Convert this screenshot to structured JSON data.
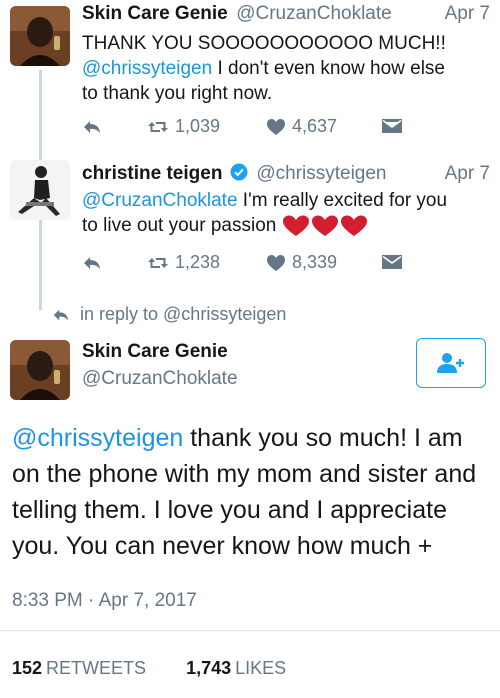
{
  "tweet1": {
    "name": "Skin Care Genie",
    "handle": "@CruzanChoklate",
    "date": "Apr 7",
    "line1": "THANK YOU SOOOOOOOOOOO MUCH!!",
    "mention": "@chrissyteigen",
    "line2_rest": " I don't even know how else",
    "line3": "to thank you right now.",
    "retweets": "1,039",
    "likes": "4,637"
  },
  "tweet2": {
    "name": "christine teigen",
    "handle": "@chrissyteigen",
    "date": "Apr 7",
    "mention": "@CruzanChoklate",
    "line1_rest": " I'm really excited for you",
    "line2": "to live out your passion",
    "retweets": "1,238",
    "likes": "8,339"
  },
  "reply_context": "in reply to @chrissyteigen",
  "main_tweet": {
    "name": "Skin Care Genie",
    "handle": "@CruzanChoklate",
    "mention": "@chrissyteigen",
    "line1_rest": " thank you so much! I am",
    "line2": "on the phone with my mom and sister and",
    "line3": "telling them. I love you and I appreciate",
    "line4": "you. You can never know how much +",
    "timestamp": "8:33 PM · Apr 7, 2017",
    "retweet_count": "152",
    "retweet_label": "RETWEETS",
    "like_count": "1,743",
    "like_label": "LIKES"
  },
  "icons": {
    "reply": "reply-icon",
    "retweet": "retweet-icon",
    "like": "heart-icon",
    "dm": "envelope-icon",
    "verified": "verified-badge-icon",
    "follow": "follow-user-icon",
    "hearts": "red-heart-emoji"
  },
  "colors": {
    "link": "#1b95e0",
    "muted": "#657786",
    "brand": "#1da1f2",
    "heart_emoji": "#d11f2f"
  }
}
